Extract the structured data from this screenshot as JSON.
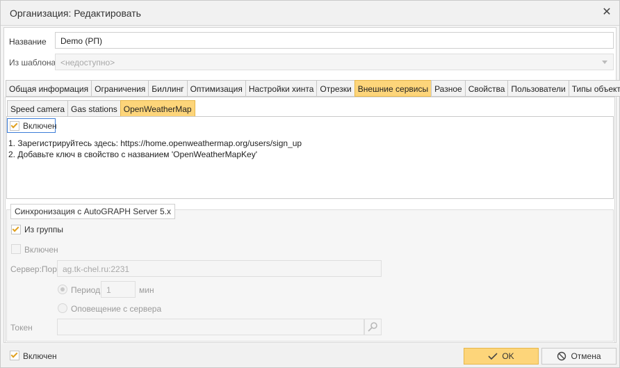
{
  "window": {
    "title": "Организация: Редактировать"
  },
  "form": {
    "name_label": "Название",
    "name_value": "Demo (РП)",
    "template_label": "Из шаблона",
    "template_placeholder": "<недоступно>"
  },
  "tabs": [
    {
      "label": "Общая информация",
      "active": false
    },
    {
      "label": "Ограничения",
      "active": false
    },
    {
      "label": "Биллинг",
      "active": false
    },
    {
      "label": "Оптимизация",
      "active": false
    },
    {
      "label": "Настройки хинта",
      "active": false
    },
    {
      "label": "Отрезки",
      "active": false
    },
    {
      "label": "Внешние сервисы",
      "active": true
    },
    {
      "label": "Разное",
      "active": false
    },
    {
      "label": "Свойства",
      "active": false
    },
    {
      "label": "Пользователи",
      "active": false
    },
    {
      "label": "Типы объектов",
      "active": false
    }
  ],
  "subtabs": [
    {
      "label": "Speed camera",
      "active": false
    },
    {
      "label": "Gas stations",
      "active": false
    },
    {
      "label": "OpenWeatherMap",
      "active": true
    }
  ],
  "service": {
    "enabled_label": "Включен",
    "enabled": true,
    "instructions": [
      "1. Зарегистрируйтесь здесь: https://home.openweathermap.org/users/sign_up",
      "2. Добавьте ключ в свойство с названием 'OpenWeatherMapKey'"
    ]
  },
  "sync": {
    "section_title": "Синхронизация с AutoGRAPH Server 5.x",
    "from_group_label": "Из группы",
    "from_group_checked": true,
    "enabled_label": "Включен",
    "enabled_checked": false,
    "server_label": "Сервер:Порт",
    "server_placeholder": "ag.tk-chel.ru:2231",
    "period_label": "Период",
    "period_value": "1",
    "period_unit": "мин",
    "notify_label": "Оповещение с сервера",
    "token_label": "Токен"
  },
  "footer": {
    "enabled_label": "Включен",
    "enabled": true,
    "ok_label": "OK",
    "cancel_label": "Отмена"
  },
  "colors": {
    "accent": "#fdd57a",
    "accent_border": "#e5b64a",
    "check": "#e0a020",
    "focus": "#3b7dd8"
  }
}
